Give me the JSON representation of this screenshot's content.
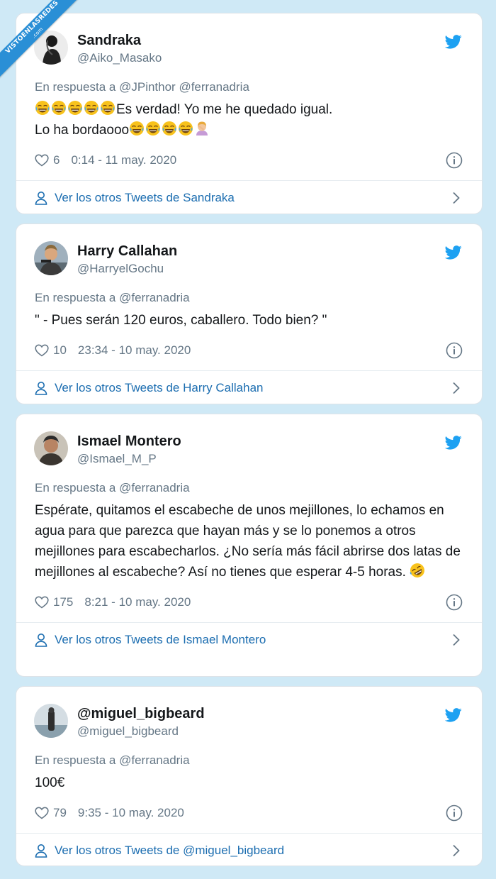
{
  "watermark": {
    "line1": "VISTOENLASREDES",
    "line2": ".com"
  },
  "colors": {
    "link": "#1b6db0",
    "twitter_blue": "#1da1f2",
    "muted": "#657786",
    "background": "#cfe9f6"
  },
  "tweets": [
    {
      "name": "Sandraka",
      "handle": "@Aiko_Masako",
      "reply_prefix": "En respuesta a",
      "reply_to": "@JPinthor @ferranadria",
      "text_line1": "Es verdad! Yo me he quedado igual.",
      "text_line2": "Lo ha bordaooo",
      "likes": "6",
      "timestamp": "0:14 - 11 may. 2020",
      "footer": "Ver los otros Tweets de Sandraka"
    },
    {
      "name": "Harry Callahan",
      "handle": "@HarryelGochu",
      "reply_prefix": "En respuesta a",
      "reply_to": "@ferranadria",
      "text": "\" - Pues serán 120 euros, caballero. Todo bien? \"",
      "likes": "10",
      "timestamp": "23:34 - 10 may. 2020",
      "footer": "Ver los otros Tweets de Harry Callahan"
    },
    {
      "name": "Ismael Montero",
      "handle": "@Ismael_M_P",
      "reply_prefix": "En respuesta a",
      "reply_to": "@ferranadria",
      "text": "Espérate, quitamos el escabeche de unos mejillones, lo echamos en agua para que parezca que hayan más y se lo ponemos a otros mejillones para escabecharlos. ¿No sería más fácil abrirse dos latas de mejillones al escabeche? Así no tienes que esperar 4-5 horas.",
      "likes": "175",
      "timestamp": "8:21 - 10 may. 2020",
      "footer": "Ver los otros Tweets de Ismael Montero"
    },
    {
      "name": "@miguel_bigbeard",
      "handle": "@miguel_bigbeard",
      "reply_prefix": "En respuesta a",
      "reply_to": "@ferranadria",
      "text": "100€",
      "likes": "79",
      "timestamp": "9:35 - 10 may. 2020",
      "footer": "Ver los otros Tweets de @miguel_bigbeard"
    }
  ]
}
